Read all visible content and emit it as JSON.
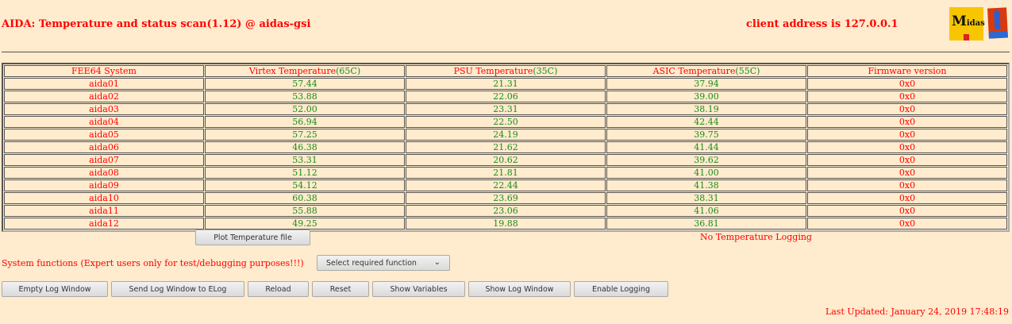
{
  "header": {
    "title": "AIDA: Temperature and status scan(1.12) @ aidas-gsi",
    "client": "client address is 127.0.0.1",
    "logo_text": "Midas"
  },
  "table": {
    "headers": [
      {
        "label": "FEE64 System",
        "limit": ""
      },
      {
        "label": "Virtex Temperature",
        "limit": "(65C)"
      },
      {
        "label": "PSU Temperature",
        "limit": "(35C)"
      },
      {
        "label": "ASIC Temperature",
        "limit": "(55C)"
      },
      {
        "label": "Firmware version",
        "limit": ""
      }
    ],
    "rows": [
      [
        "aida01",
        "57.44",
        "21.31",
        "37.94",
        "0x0"
      ],
      [
        "aida02",
        "53.88",
        "22.06",
        "39.00",
        "0x0"
      ],
      [
        "aida03",
        "52.00",
        "23.31",
        "38.19",
        "0x0"
      ],
      [
        "aida04",
        "56.94",
        "22.50",
        "42.44",
        "0x0"
      ],
      [
        "aida05",
        "57.25",
        "24.19",
        "39.75",
        "0x0"
      ],
      [
        "aida06",
        "46.38",
        "21.62",
        "41.44",
        "0x0"
      ],
      [
        "aida07",
        "53.31",
        "20.62",
        "39.62",
        "0x0"
      ],
      [
        "aida08",
        "51.12",
        "21.81",
        "41.00",
        "0x0"
      ],
      [
        "aida09",
        "54.12",
        "22.44",
        "41.38",
        "0x0"
      ],
      [
        "aida10",
        "60.38",
        "23.69",
        "38.31",
        "0x0"
      ],
      [
        "aida11",
        "55.88",
        "23.06",
        "41.06",
        "0x0"
      ],
      [
        "aida12",
        "49.25",
        "19.88",
        "36.81",
        "0x0"
      ]
    ]
  },
  "plot_button": "Plot Temperature file",
  "logging_status": "No Temperature Logging",
  "system_functions_label": "System functions (Expert users only for test/debugging purposes!!!)",
  "function_select": "Select required function",
  "buttons": [
    "Empty Log Window",
    "Send Log Window to ELog",
    "Reload",
    "Reset",
    "Show Variables",
    "Show Log Window",
    "Enable Logging"
  ],
  "last_updated": "Last Updated: January 24, 2019 17:48:19"
}
